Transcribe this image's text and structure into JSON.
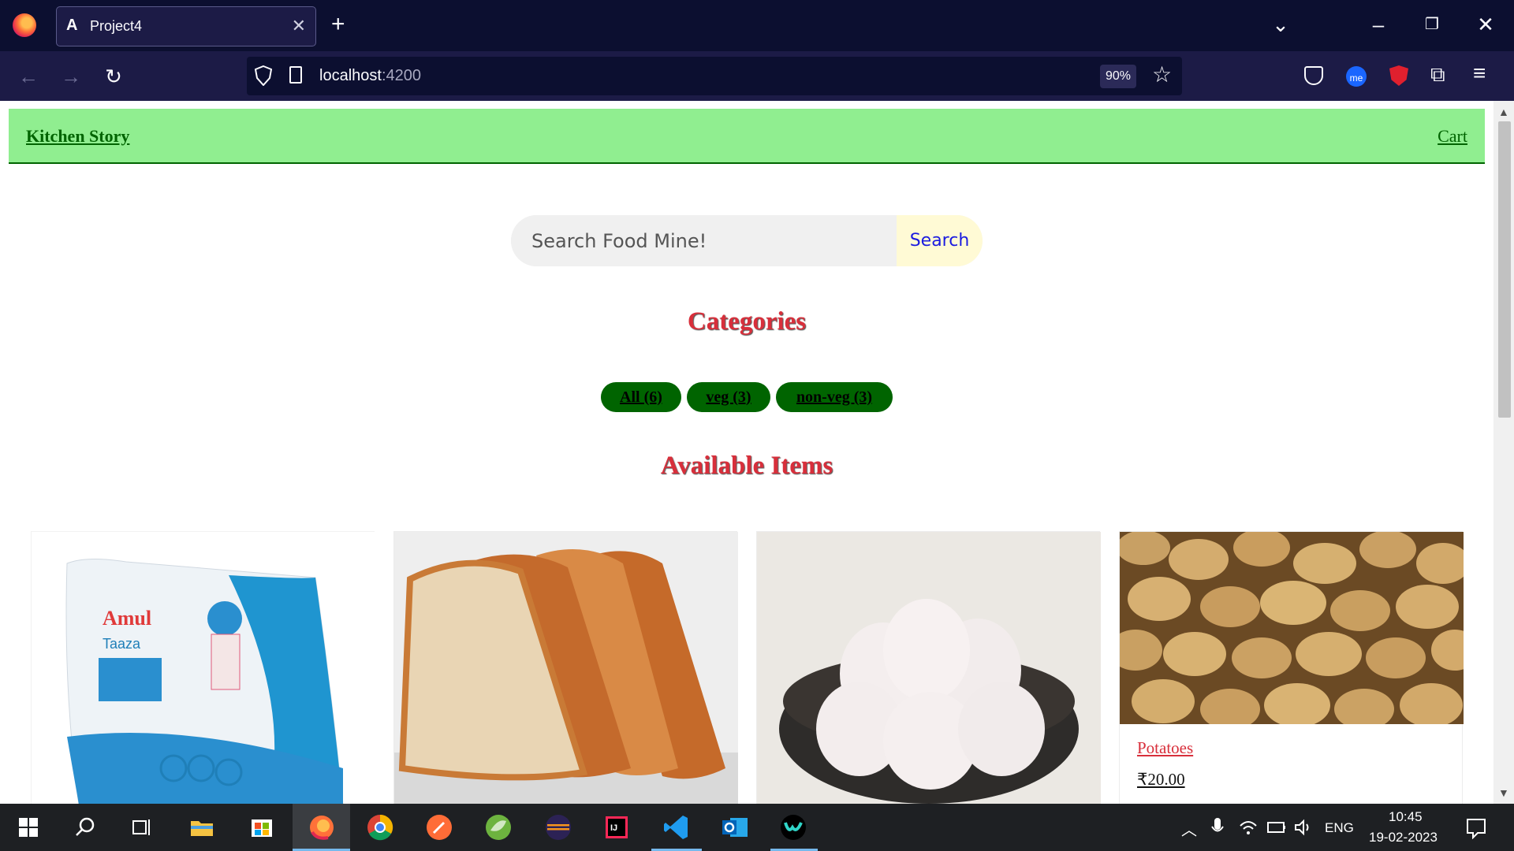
{
  "browser": {
    "tab_title": "Project4",
    "url_host": "localhost",
    "url_port": ":4200",
    "zoom": "90%"
  },
  "site": {
    "brand": "Kitchen Story",
    "cart": "Cart",
    "search_placeholder": "Search Food Mine!",
    "search_button": "Search",
    "categories_title": "Categories",
    "tags": [
      "All (6)",
      "veg (3)",
      "non-veg (3)"
    ],
    "available_title": "Available Items",
    "items": [
      {
        "image": "milk-packet-image",
        "name": "",
        "price": ""
      },
      {
        "image": "bread-image",
        "name": "",
        "price": ""
      },
      {
        "image": "eggs-image",
        "name": "",
        "price": ""
      },
      {
        "image": "potatoes-image",
        "name": "Potatoes",
        "price": "₹20.00"
      }
    ]
  },
  "taskbar": {
    "language": "ENG",
    "time": "10:45",
    "date": "19-02-2023"
  },
  "colors": {
    "header_bg": "#90ee90",
    "tag_bg": "#006400",
    "title_red": "#d82f3b",
    "chrome_dark": "#0c0f30"
  }
}
